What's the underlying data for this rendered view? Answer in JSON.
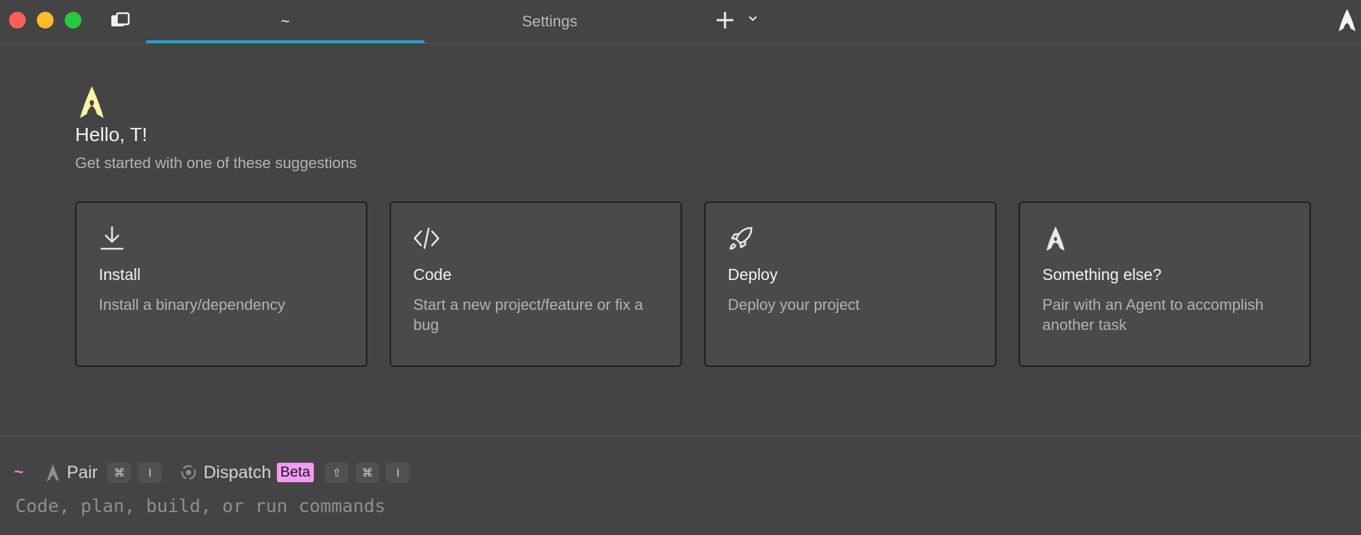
{
  "titlebar": {
    "tabs": [
      {
        "label": "~",
        "active": true
      },
      {
        "label": "Settings",
        "active": false
      }
    ],
    "accent_color": "#2f9bd6"
  },
  "welcome": {
    "greeting": "Hello, T!",
    "subtitle": "Get started with one of these suggestions",
    "logo_color": "#fff3a6"
  },
  "cards": [
    {
      "icon": "download-icon",
      "title": "Install",
      "description": "Install a binary/dependency"
    },
    {
      "icon": "code-icon",
      "title": "Code",
      "description": "Start a new project/feature or fix a bug"
    },
    {
      "icon": "rocket-icon",
      "title": "Deploy",
      "description": "Deploy your project"
    },
    {
      "icon": "agent-icon",
      "title": "Something else?",
      "description": "Pair with an Agent to accomplish another task"
    }
  ],
  "input_bar": {
    "cwd": "~",
    "pair": {
      "label": "Pair",
      "shortcut": [
        "⌘",
        "I"
      ]
    },
    "dispatch": {
      "label": "Dispatch",
      "badge": "Beta",
      "shortcut": [
        "⇧",
        "⌘",
        "I"
      ]
    },
    "placeholder": "Code, plan, build, or run commands"
  }
}
